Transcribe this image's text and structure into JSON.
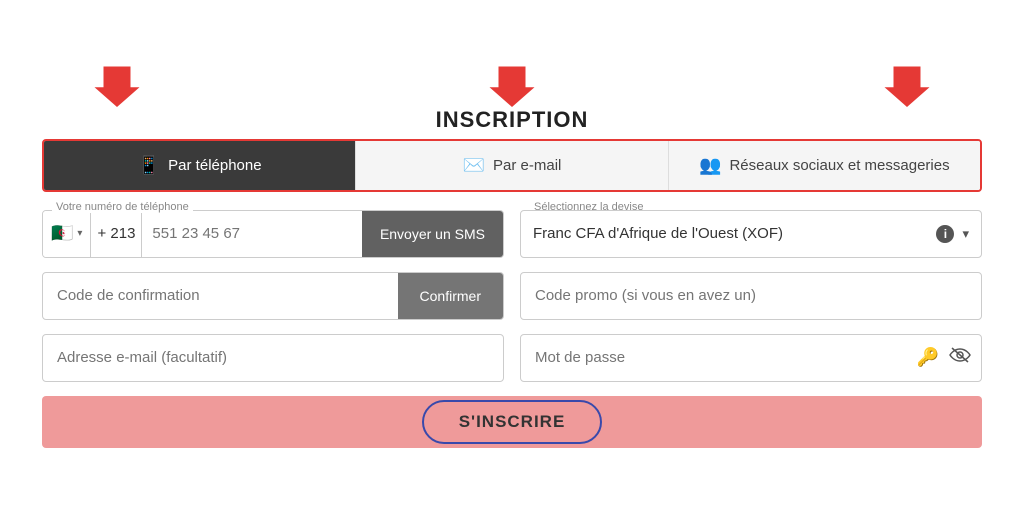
{
  "header": {
    "title": "INSCRIPTION",
    "arrow_label": "arrow-down"
  },
  "tabs": [
    {
      "id": "phone",
      "label": "Par téléphone",
      "icon": "📱",
      "active": true
    },
    {
      "id": "email",
      "label": "Par e-mail",
      "icon": "✉️",
      "active": false
    },
    {
      "id": "social",
      "label": "Réseaux sociaux et messageries",
      "icon": "👥",
      "active": false
    }
  ],
  "form": {
    "phone_section": {
      "label": "Votre numéro de téléphone",
      "flag": "🇩🇿",
      "prefix": "+ 213",
      "placeholder": "551 23 45 67",
      "sms_button": "Envoyer un SMS"
    },
    "devise_section": {
      "label": "Sélectionnez la devise",
      "value": "Franc CFA d'Afrique de l'Ouest (XOF)"
    },
    "confirmation_section": {
      "placeholder": "Code de confirmation",
      "confirm_button": "Confirmer"
    },
    "promo_section": {
      "placeholder": "Code promo (si vous en avez un)"
    },
    "email_section": {
      "placeholder": "Adresse e-mail (facultatif)"
    },
    "password_section": {
      "placeholder": "Mot de passe"
    },
    "submit_button": "S'INSCRIRE"
  }
}
